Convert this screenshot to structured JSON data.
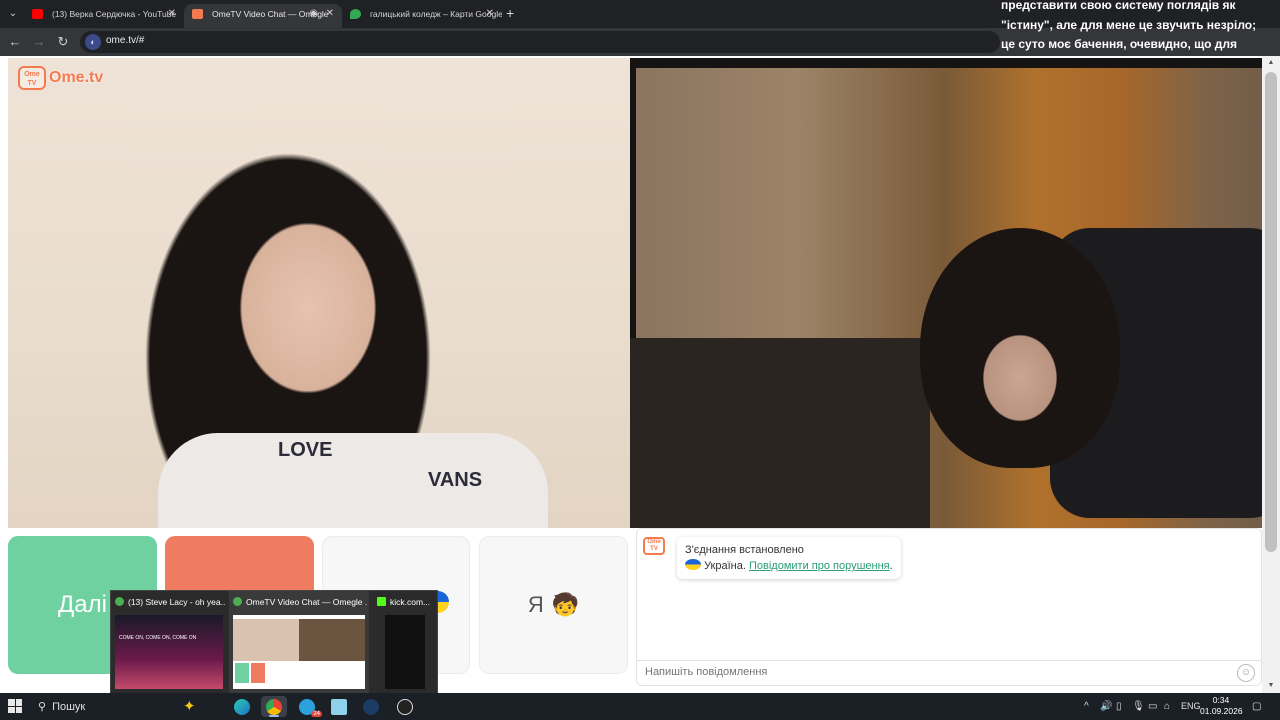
{
  "browser": {
    "tabs": [
      {
        "label": "(13) Верка Сердючка - YouTube",
        "favicon_color": "#ff0000",
        "active": false
      },
      {
        "label": "OmeTV Video Chat — Omegle",
        "favicon_color": "#f47a4f",
        "active": true
      },
      {
        "label": "галицький коледж – Карти Google",
        "favicon_color": "#34a853",
        "active": false
      }
    ],
    "url": "ome.tv/#"
  },
  "caption_overlay": "представити свою систему поглядів як \"істину\", але для мене це звучить незріло; це суто моє бачення, очевидно, що для суспільства це здебільшого",
  "page": {
    "logo": {
      "box": "Ome TV",
      "text": "Ome.tv"
    },
    "shirt_text": [
      "LOVE",
      "VANS"
    ],
    "buttons": {
      "next": "Далі",
      "gender": "Я",
      "gender_emoji": "🧒"
    },
    "chat": {
      "status": "З'єднання встановлено",
      "country": "Україна.",
      "report_link": "Повідомити про порушення",
      "report_suffix": ".",
      "input_placeholder": "Напишіть повідомлення",
      "emoji_icon": "☺"
    }
  },
  "task_preview": [
    {
      "title": "(13) Steve Lacy - oh yea...",
      "thumb_text": "COME ON, COME ON, COME ON"
    },
    {
      "title": "OmeTV Video Chat — Omegle ..."
    },
    {
      "title": "kick.com..."
    }
  ],
  "taskbar": {
    "search_label": "Пошук",
    "badge": "24",
    "language": "ENG",
    "time": "0:34",
    "date": "01.09.2026"
  },
  "colors": {
    "accent_green": "#6fd0a0",
    "accent_orange": "#ef7b61",
    "brand": "#f47a4f",
    "link": "#2a9c76"
  }
}
